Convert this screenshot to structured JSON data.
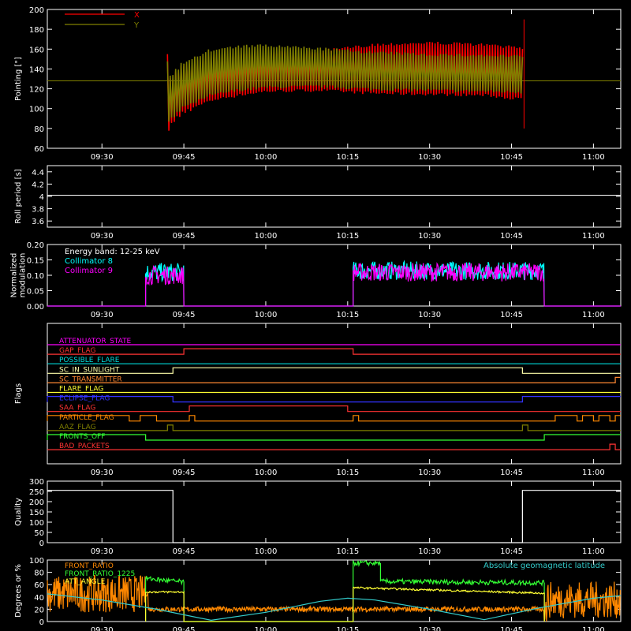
{
  "time_axis": {
    "range": [
      "09:20",
      "11:05"
    ],
    "ticks": [
      "09:30",
      "09:45",
      "10:00",
      "10:15",
      "10:30",
      "10:45",
      "11:00"
    ]
  },
  "chart_data": [
    {
      "type": "line",
      "ylabel": "Pointing [\"]",
      "ylim": [
        60,
        200
      ],
      "yticks": [
        60,
        80,
        100,
        120,
        140,
        160,
        180,
        200
      ],
      "legend": {
        "placement": "top-left",
        "entries": [
          "X",
          "Y"
        ]
      },
      "series": [
        {
          "name": "X",
          "color": "#ff0000",
          "baseline": 128,
          "x": [
            "09:42",
            "09:43",
            "09:45",
            "09:50",
            "09:55",
            "10:00",
            "10:10",
            "10:20",
            "10:30",
            "10:40",
            "10:47"
          ],
          "upper": [
            155,
            132,
            145,
            152,
            156,
            158,
            159,
            166,
            168,
            166,
            163
          ],
          "lower": [
            75,
            85,
            95,
            107,
            112,
            116,
            117,
            114,
            113,
            112,
            108
          ]
        },
        {
          "name": "Y",
          "color": "#808000",
          "baseline": 128,
          "x": [
            "09:42",
            "09:43",
            "09:45",
            "09:50",
            "09:55",
            "10:00",
            "10:10",
            "10:20",
            "10:30",
            "10:40",
            "10:47"
          ],
          "upper": [
            150,
            135,
            148,
            160,
            164,
            165,
            162,
            158,
            156,
            155,
            154
          ],
          "lower": [
            85,
            90,
            100,
            112,
            117,
            120,
            121,
            118,
            117,
            116,
            115
          ]
        }
      ]
    },
    {
      "type": "line",
      "ylabel": "Roll period [s]",
      "ylim": [
        3.5,
        4.5
      ],
      "yticks": [
        3.6,
        3.8,
        4.0,
        4.2,
        4.4
      ],
      "series": [
        {
          "color": "#ffffff",
          "x": [
            "09:20",
            "11:05"
          ],
          "y": [
            4.02,
            4.02
          ]
        }
      ]
    },
    {
      "type": "line",
      "ylabel": "Normalized modulation",
      "ylim": [
        0,
        0.2
      ],
      "yticks": [
        "0.00",
        "0.05",
        "0.10",
        "0.15",
        "0.20"
      ],
      "annotation": "Energy band: 12-25 keV",
      "legend": {
        "placement": "top-left",
        "entries": [
          "Collimator 8",
          "Collimator 9"
        ]
      },
      "series": [
        {
          "name": "Collimator 8",
          "color": "#00ffff",
          "segments": [
            {
              "x": [
                "09:38",
                "09:45"
              ],
              "mean": 0.11
            },
            {
              "x": [
                "10:16",
                "10:51"
              ],
              "mean": 0.115
            }
          ]
        },
        {
          "name": "Collimator 9",
          "color": "#ff00ff",
          "segments": [
            {
              "x": [
                "09:38",
                "09:45"
              ],
              "mean": 0.1
            },
            {
              "x": [
                "10:16",
                "10:51"
              ],
              "mean": 0.11
            }
          ]
        }
      ]
    },
    {
      "type": "line",
      "ylabel": "Flags",
      "flags": [
        {
          "name": "ATTENUATOR_STATE",
          "color": "#ff00ff",
          "high": []
        },
        {
          "name": "GAP_FLAG",
          "color": "#ff3333",
          "high": [
            [
              "09:45",
              "10:16"
            ]
          ]
        },
        {
          "name": "POSSIBLE_FLARE",
          "color": "#00dddd",
          "high": []
        },
        {
          "name": "SC_IN_SUNLIGHT",
          "color": "#ffffaa",
          "high": [
            [
              "09:43",
              "10:47"
            ]
          ]
        },
        {
          "name": "SC_TRANSMITTER",
          "color": "#ff8833",
          "high": [
            [
              "11:04",
              "11:05"
            ]
          ]
        },
        {
          "name": "FLARE_FLAG",
          "color": "#ffff33",
          "high": []
        },
        {
          "name": "ECLIPSE_FLAG",
          "color": "#3333ff",
          "high": [
            [
              "09:20",
              "09:43"
            ],
            [
              "10:47",
              "11:05"
            ]
          ]
        },
        {
          "name": "SAA_FLAG",
          "color": "#ff3333",
          "high": [
            [
              "09:46",
              "10:15"
            ]
          ]
        },
        {
          "name": "PARTICLE_FLAG",
          "color": "#ff8800",
          "high": [
            [
              "09:20",
              "09:35"
            ],
            [
              "09:37",
              "09:40"
            ],
            [
              "09:46",
              "09:47"
            ],
            [
              "10:16",
              "10:17"
            ],
            [
              "10:53",
              "10:57"
            ],
            [
              "10:58",
              "11:00"
            ],
            [
              "11:01",
              "11:03"
            ],
            [
              "11:04",
              "11:05"
            ]
          ]
        },
        {
          "name": "AAZ_FLAG",
          "color": "#808000",
          "high": [
            [
              "09:42",
              "09:43"
            ],
            [
              "10:47",
              "10:48"
            ]
          ]
        },
        {
          "name": "FRONTS_OFF",
          "color": "#33ff33",
          "high": [
            [
              "09:20",
              "09:38"
            ],
            [
              "10:51",
              "11:05"
            ]
          ]
        },
        {
          "name": "BAD_PACKETS",
          "color": "#ff3333",
          "high": [
            [
              "11:03",
              "11:04"
            ]
          ]
        }
      ]
    },
    {
      "type": "line",
      "ylabel": "Quality",
      "ylim": [
        0,
        300
      ],
      "yticks": [
        0,
        50,
        100,
        150,
        200,
        250,
        300
      ],
      "series": [
        {
          "color": "#ffffff",
          "x": [
            "09:20",
            "09:43",
            "09:43",
            "10:47",
            "10:47",
            "11:05"
          ],
          "y": [
            255,
            255,
            0,
            0,
            255,
            255
          ]
        }
      ]
    },
    {
      "type": "line",
      "ylabel": "Degrees or %",
      "ylim": [
        0,
        100
      ],
      "yticks": [
        0,
        20,
        40,
        60,
        80,
        100
      ],
      "legend": {
        "placement": "top-left",
        "entries": [
          "FRONT_RATIO",
          "FRONT_RATIO_1225",
          "ATT_ANGLE"
        ]
      },
      "annotation": "Absolute geomagnetic latitude",
      "series": [
        {
          "name": "FRONT_RATIO",
          "color": "#ff8800",
          "x": [
            "09:20",
            "09:38",
            "09:38",
            "09:45",
            "10:16",
            "10:16",
            "10:51",
            "10:51",
            "11:05"
          ],
          "y": [
            45,
            45,
            20,
            20,
            20,
            20,
            20,
            35,
            35
          ]
        },
        {
          "name": "FRONT_RATIO_1225",
          "color": "#33ff33",
          "x": [
            "09:38",
            "09:38",
            "09:45",
            "09:45",
            "10:16",
            "10:16",
            "10:21",
            "10:21",
            "10:51",
            "10:51"
          ],
          "y": [
            0,
            70,
            64,
            0,
            0,
            95,
            95,
            65,
            63,
            0
          ]
        },
        {
          "name": "ATT_ANGLE",
          "color": "#ffff33",
          "x": [
            "09:38",
            "09:38",
            "09:45",
            "09:45",
            "10:16",
            "10:16",
            "10:51",
            "10:51"
          ],
          "y": [
            0,
            48,
            48,
            0,
            0,
            55,
            46,
            0
          ]
        },
        {
          "name": "Absolute geomagnetic latitude",
          "color": "#33cccc",
          "x": [
            "09:20",
            "09:30",
            "09:40",
            "09:50",
            "10:00",
            "10:10",
            "10:15",
            "10:20",
            "10:30",
            "10:40",
            "10:50",
            "11:00",
            "11:05"
          ],
          "y": [
            45,
            35,
            20,
            2,
            15,
            33,
            38,
            35,
            20,
            3,
            22,
            38,
            42
          ]
        }
      ]
    }
  ]
}
